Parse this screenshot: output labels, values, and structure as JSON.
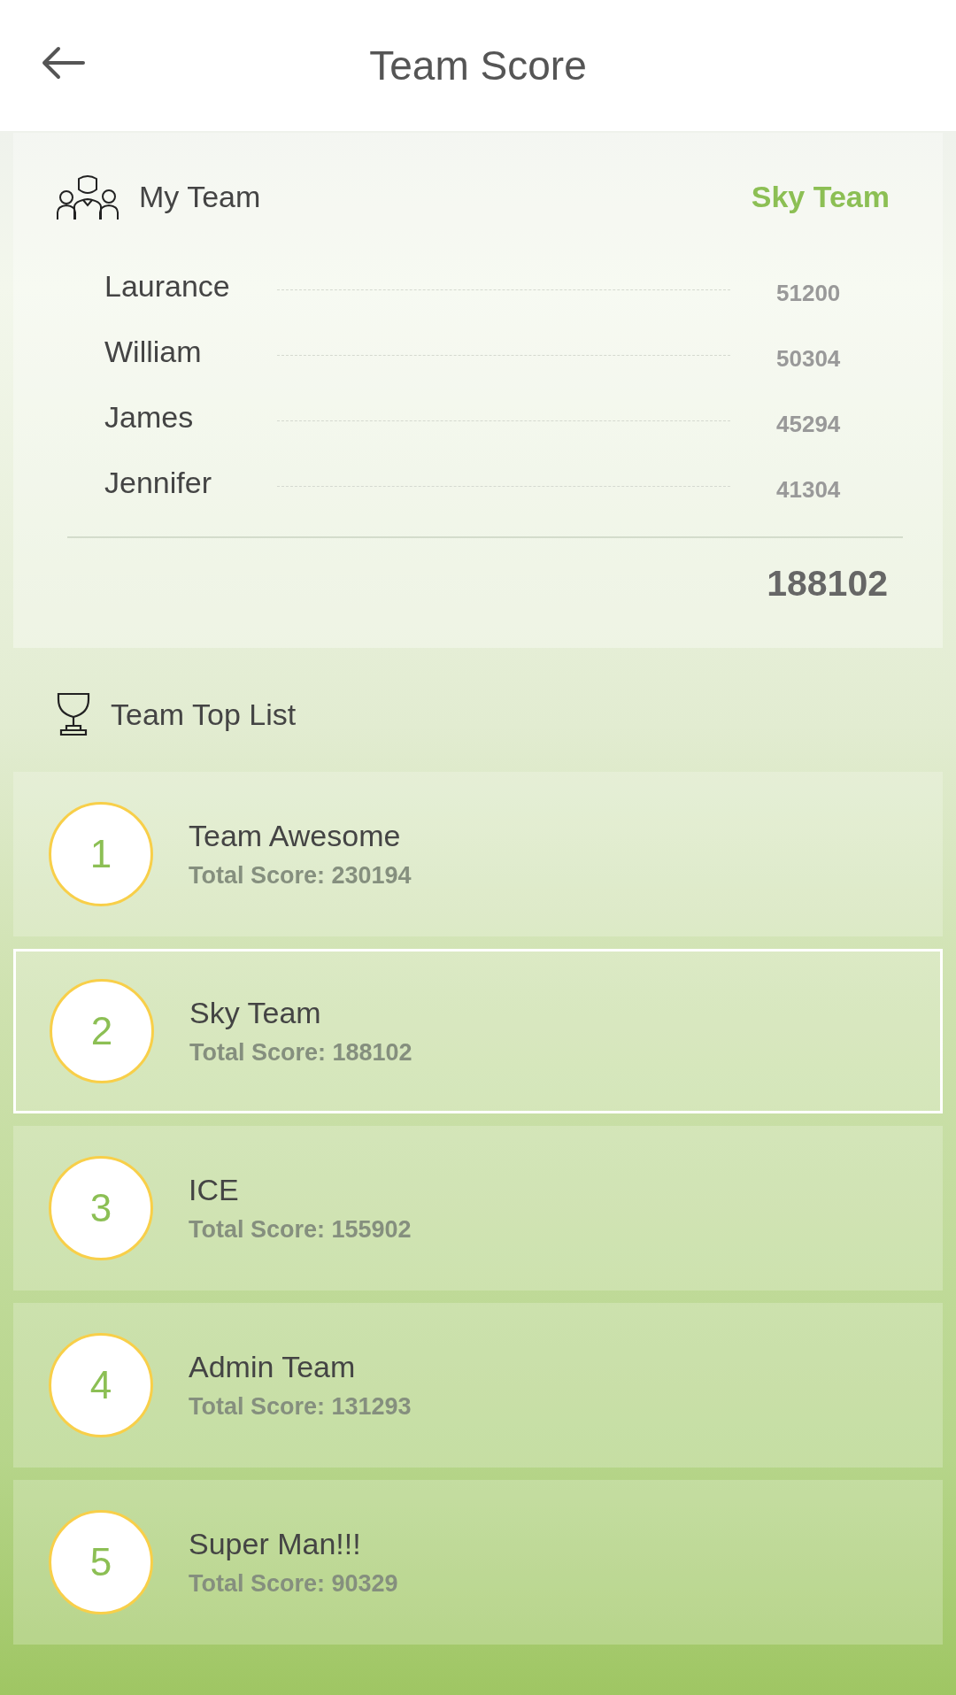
{
  "header": {
    "title": "Team Score"
  },
  "my_team": {
    "label": "My Team",
    "team_name": "Sky Team",
    "members": [
      {
        "name": "Laurance",
        "score": "51200"
      },
      {
        "name": "William",
        "score": "50304"
      },
      {
        "name": "James",
        "score": "45294"
      },
      {
        "name": "Jennifer",
        "score": "41304"
      }
    ],
    "total": "188102"
  },
  "top_list": {
    "label": "Team Top List",
    "teams": [
      {
        "rank": "1",
        "name": "Team Awesome",
        "score": "Total Score: 230194",
        "selected": false
      },
      {
        "rank": "2",
        "name": "Sky Team",
        "score": "Total Score: 188102",
        "selected": true
      },
      {
        "rank": "3",
        "name": "ICE",
        "score": "Total Score: 155902",
        "selected": false
      },
      {
        "rank": "4",
        "name": "Admin Team",
        "score": "Total Score: 131293",
        "selected": false
      },
      {
        "rank": "5",
        "name": "Super Man!!!",
        "score": "Total Score: 90329",
        "selected": false
      }
    ]
  }
}
